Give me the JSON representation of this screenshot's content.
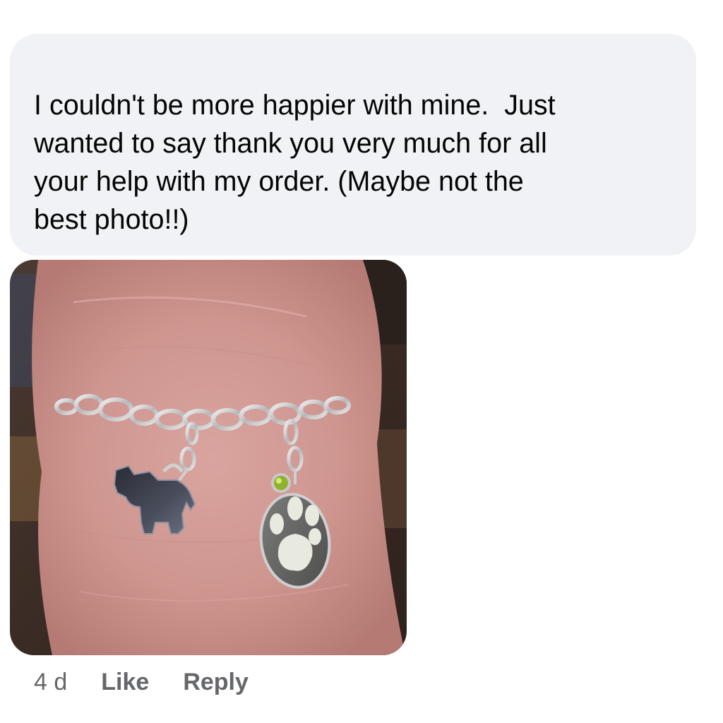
{
  "comment": {
    "author": "",
    "text": "I couldn't be more happier with mine.  Just\nwanted to say thank you very much for all\nyour help with my order. (Maybe not the\nbest photo!!)",
    "bubble_color": "#f0f2f5",
    "text_color": "#050505"
  },
  "photo": {
    "description_icon": "bracelet-photo",
    "charms": [
      "dog-charm",
      "paw-print-charm",
      "green-birthstone-charm"
    ]
  },
  "actions": {
    "timestamp": "4 d",
    "like_label": "Like",
    "reply_label": "Reply",
    "meta_color": "#65676b"
  }
}
